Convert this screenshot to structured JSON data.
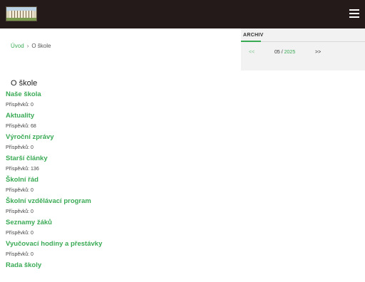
{
  "header": {
    "menu_icon": "hamburger-menu-icon",
    "logo": "school-building-logo"
  },
  "breadcrumb": {
    "home": "Úvod",
    "separator": "›",
    "current": "O škole"
  },
  "sidebar": {
    "title": "ARCHIV",
    "prev": "<<",
    "month": "05",
    "slash": " / ",
    "year": "2025",
    "next": ">>"
  },
  "page_title": "O škole",
  "count_label": "Příspěvků:",
  "categories": [
    {
      "name": "Naše škola",
      "count": "0"
    },
    {
      "name": "Aktuality",
      "count": "68"
    },
    {
      "name": "Výroční zprávy",
      "count": "0"
    },
    {
      "name": "Starší články",
      "count": "136"
    },
    {
      "name": "Školní řád",
      "count": "0"
    },
    {
      "name": "Školní vzdělávací program",
      "count": "0"
    },
    {
      "name": "Seznamy žáků",
      "count": "0"
    },
    {
      "name": "Vyučovací hodiny a přestávky",
      "count": "0"
    },
    {
      "name": "Rada školy",
      "count": ""
    }
  ],
  "colors": {
    "accent": "#3aaa55",
    "header_bg": "#231a19",
    "sidebar_bg": "#f2f2f2"
  }
}
